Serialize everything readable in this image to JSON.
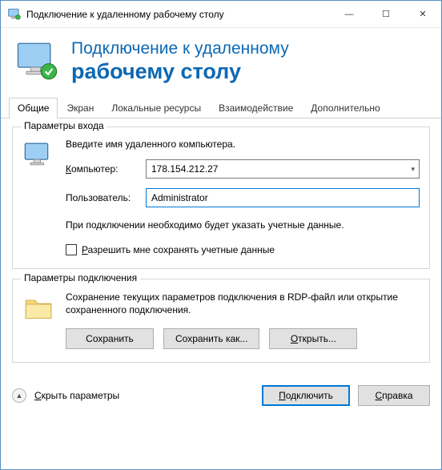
{
  "window": {
    "title": "Подключение к удаленному рабочему столу",
    "minimize": "—",
    "maximize": "☐",
    "close": "✕"
  },
  "banner": {
    "line1": "Подключение к удаленному",
    "line2": "рабочему столу"
  },
  "tabs": [
    {
      "label": "Общие",
      "active": true
    },
    {
      "label": "Экран",
      "active": false
    },
    {
      "label": "Локальные ресурсы",
      "active": false
    },
    {
      "label": "Взаимодействие",
      "active": false
    },
    {
      "label": "Дополнительно",
      "active": false
    }
  ],
  "login_group": {
    "title": "Параметры входа",
    "intro": "Введите имя удаленного компьютера.",
    "computer_label_prefix": "К",
    "computer_label_rest": "омпьютер:",
    "computer_value": "178.154.212.27",
    "user_label": "Пользователь:",
    "user_value": "Administrator",
    "note": "При подключении необходимо будет указать учетные данные.",
    "checkbox_label_prefix": "Р",
    "checkbox_label_rest": "азрешить мне сохранять учетные данные",
    "checkbox_checked": false
  },
  "conn_group": {
    "title": "Параметры подключения",
    "desc": "Сохранение текущих параметров подключения в RDP-файл или открытие сохраненного подключения.",
    "save": "Сохранить",
    "save_as": "Сохранить как...",
    "open_prefix": "О",
    "open_suffix": "...",
    "open_mid": "ткрыть"
  },
  "bottom": {
    "hide_prefix": "С",
    "hide_rest": "крыть параметры",
    "connect_prefix": "П",
    "connect_rest": "одключить",
    "help_prefix": "С",
    "help_rest": "правка"
  }
}
